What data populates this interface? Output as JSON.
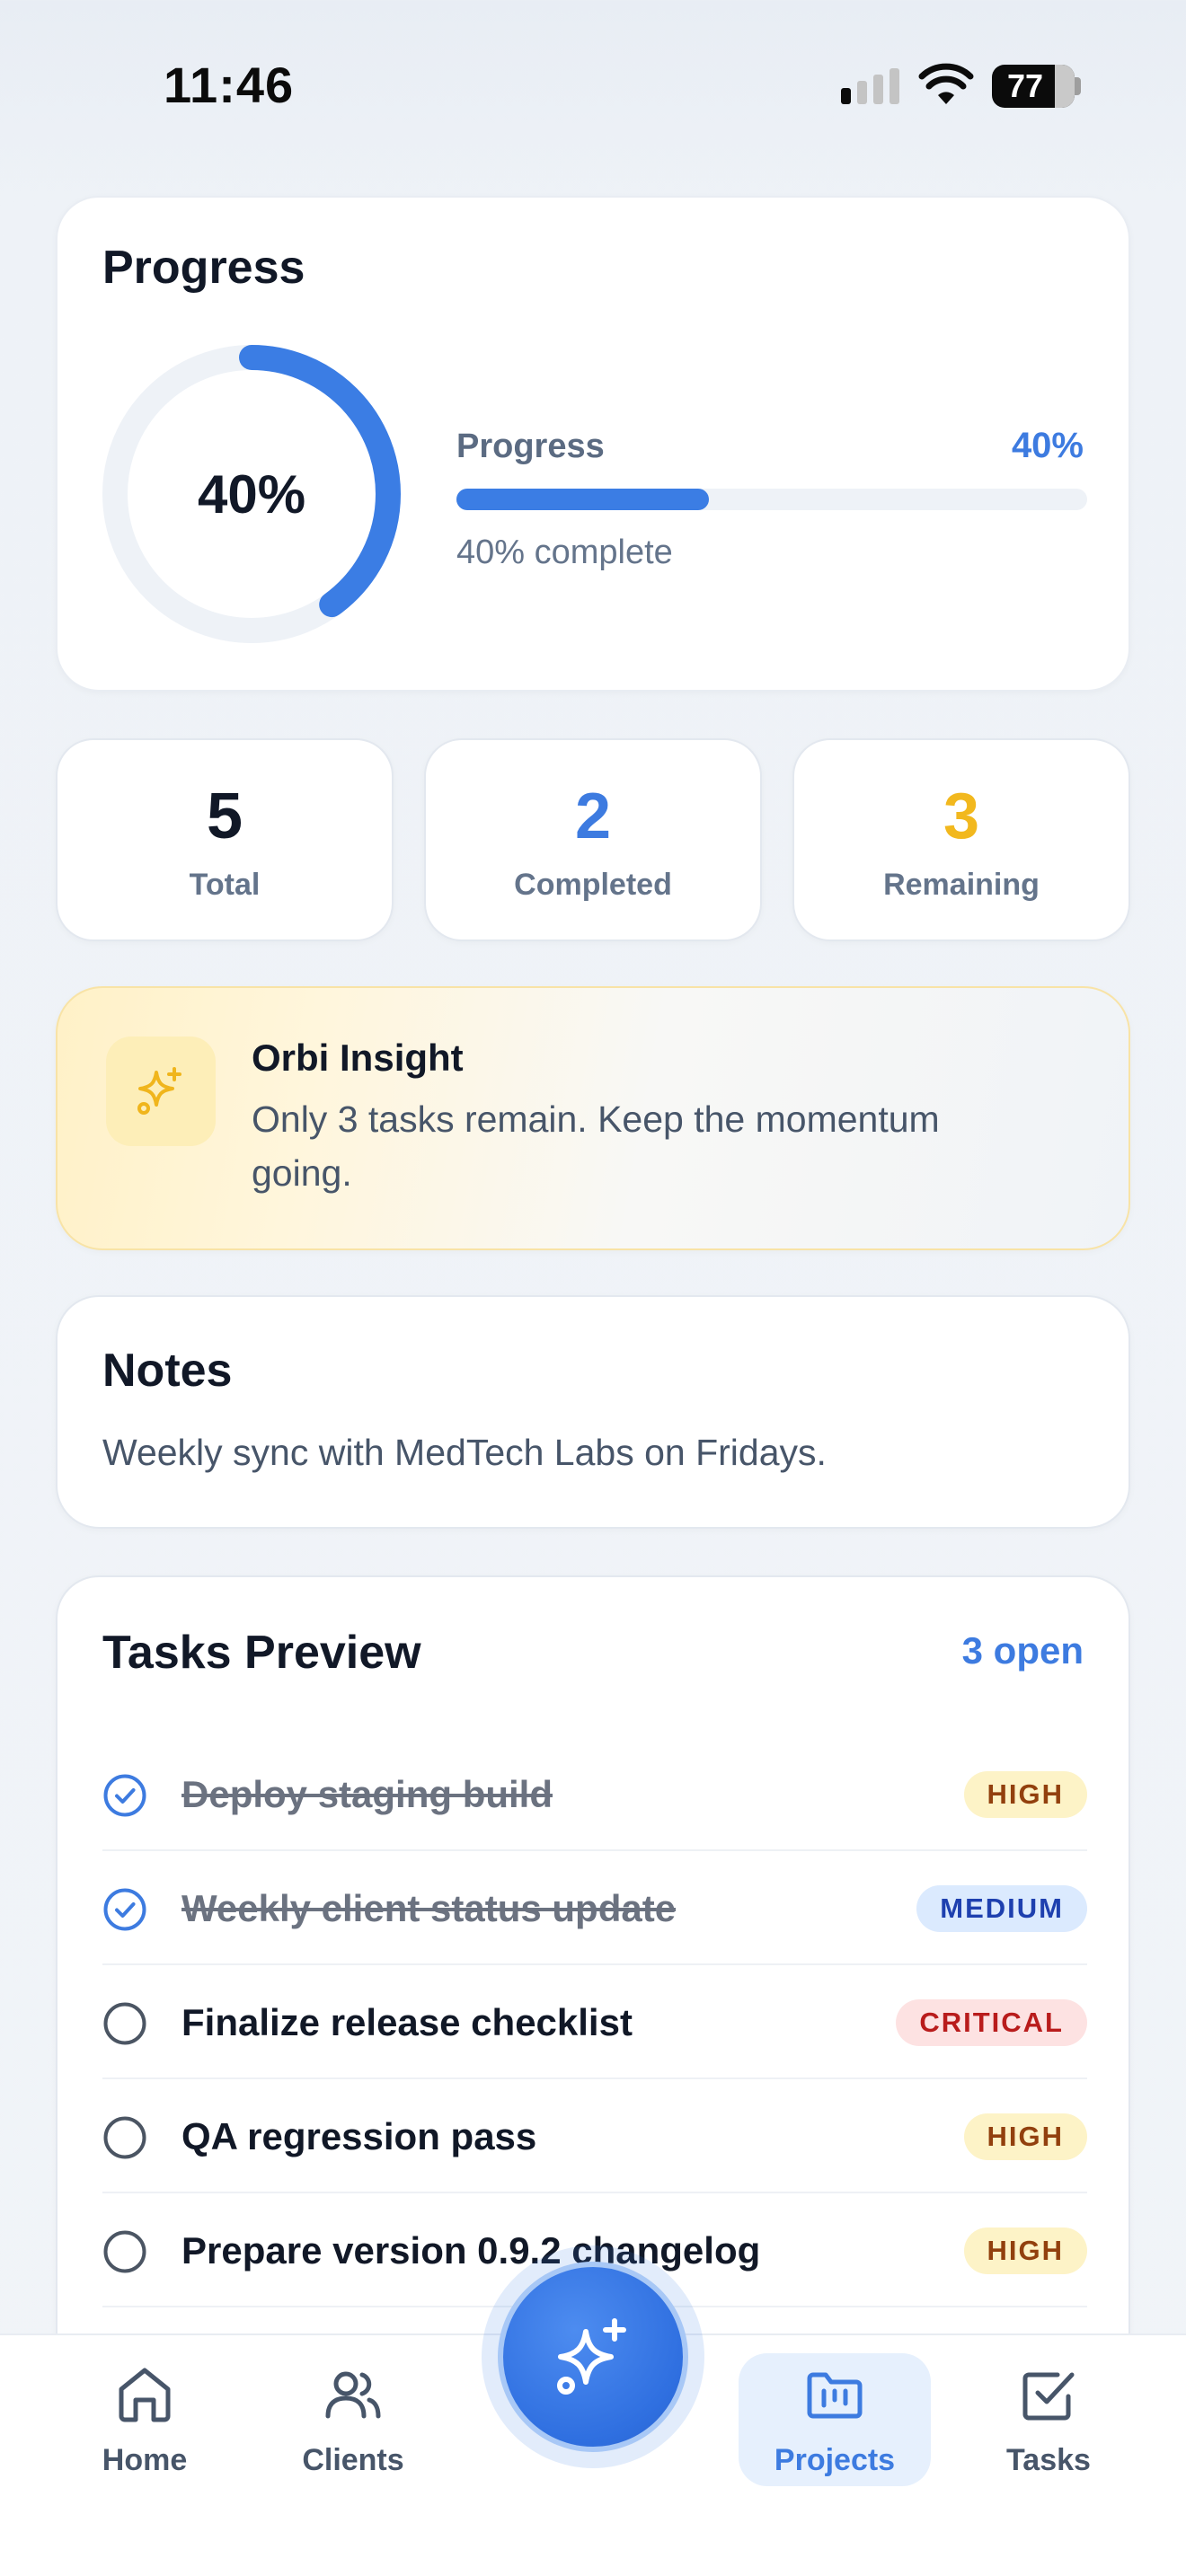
{
  "status_bar": {
    "time": "11:46",
    "battery": "77"
  },
  "progress_card": {
    "title": "Progress",
    "ring_label": "40%",
    "progress_fraction": 0.4,
    "bar_label": "Progress",
    "bar_value": "40%",
    "bar_subtitle": "40% complete",
    "accent_color": "#3b7de4"
  },
  "stats": [
    {
      "value": "5",
      "label": "Total",
      "color": "#111827"
    },
    {
      "value": "2",
      "label": "Completed",
      "color": "#3d7be0"
    },
    {
      "value": "3",
      "label": "Remaining",
      "color": "#f2b81e"
    }
  ],
  "insight": {
    "icon": "sparkles-icon",
    "title": "Orbi Insight",
    "text": "Only 3 tasks remain. Keep the momentum going."
  },
  "notes": {
    "title": "Notes",
    "text": "Weekly sync with MedTech Labs on Fridays."
  },
  "tasks_preview": {
    "title": "Tasks Preview",
    "count_label": "3 open",
    "items": [
      {
        "title": "Deploy staging build",
        "done": true,
        "priority": "HIGH"
      },
      {
        "title": "Weekly client status update",
        "done": true,
        "priority": "MEDIUM"
      },
      {
        "title": "Finalize release checklist",
        "done": false,
        "priority": "CRITICAL"
      },
      {
        "title": "QA regression pass",
        "done": false,
        "priority": "HIGH"
      },
      {
        "title": "Prepare version 0.9.2 changelog",
        "done": false,
        "priority": "HIGH"
      }
    ]
  },
  "bottom_nav": {
    "home": "Home",
    "clients": "Clients",
    "projects": "Projects",
    "tasks": "Tasks",
    "active": "projects",
    "fab_icon": "sparkles-icon"
  }
}
